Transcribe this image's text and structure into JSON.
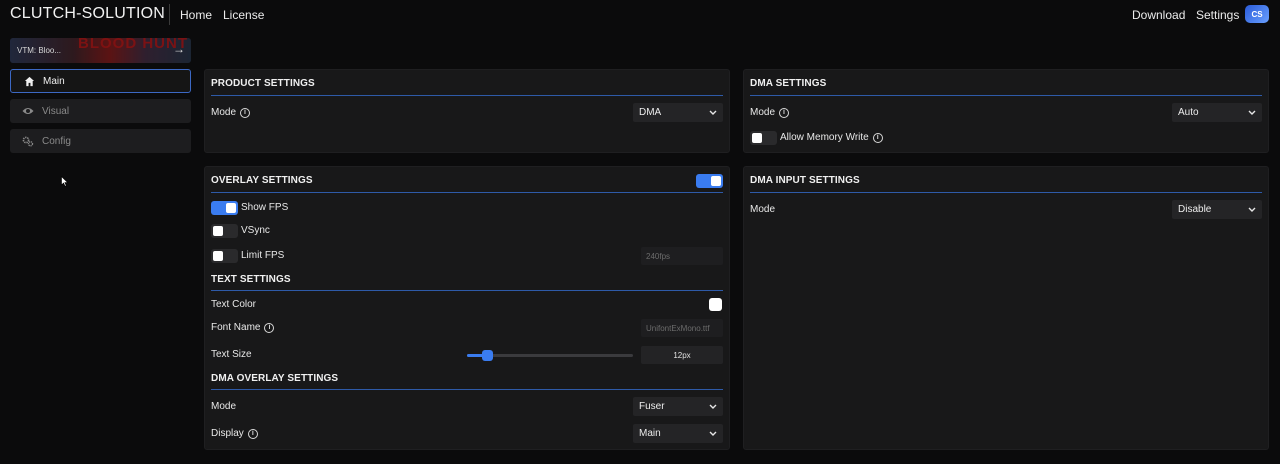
{
  "header": {
    "brand": "CLUTCH-SOLUTION",
    "nav": [
      "Home",
      "License"
    ],
    "right_nav": [
      "Download",
      "Settings"
    ],
    "avatar_text": "CS"
  },
  "sidebar": {
    "game": {
      "name": "VTM: Bloo...",
      "art_text": "BLOOD HUNT"
    },
    "items": [
      {
        "label": "Main",
        "icon": "home-icon",
        "active": true
      },
      {
        "label": "Visual",
        "icon": "eye-icon",
        "active": false
      },
      {
        "label": "Config",
        "icon": "gears-icon",
        "active": false
      }
    ]
  },
  "product_settings": {
    "title": "PRODUCT SETTINGS",
    "mode_label": "Mode",
    "mode_value": "DMA"
  },
  "dma_settings": {
    "title": "DMA SETTINGS",
    "mode_label": "Mode",
    "mode_value": "Auto",
    "allow_write_label": "Allow Memory Write",
    "allow_write_on": false
  },
  "overlay_settings": {
    "title": "OVERLAY SETTINGS",
    "enabled": true,
    "show_fps_label": "Show FPS",
    "show_fps_on": true,
    "vsync_label": "VSync",
    "vsync_on": false,
    "limit_fps_label": "Limit FPS",
    "limit_fps_on": false,
    "limit_fps_placeholder": "240fps"
  },
  "text_settings": {
    "title": "TEXT SETTINGS",
    "color_label": "Text Color",
    "color_value": "#ffffff",
    "font_label": "Font Name",
    "font_placeholder": "UnifontExMono.ttf",
    "size_label": "Text Size",
    "size_value": "12px",
    "size_fraction": 0.12
  },
  "dma_overlay_settings": {
    "title": "DMA OVERLAY SETTINGS",
    "mode_label": "Mode",
    "mode_value": "Fuser",
    "display_label": "Display",
    "display_value": "Main"
  },
  "dma_input_settings": {
    "title": "DMA INPUT SETTINGS",
    "mode_label": "Mode",
    "mode_value": "Disable"
  },
  "colors": {
    "accent": "#3a7cf0",
    "panel": "#181819",
    "background": "#0b0b0c"
  }
}
